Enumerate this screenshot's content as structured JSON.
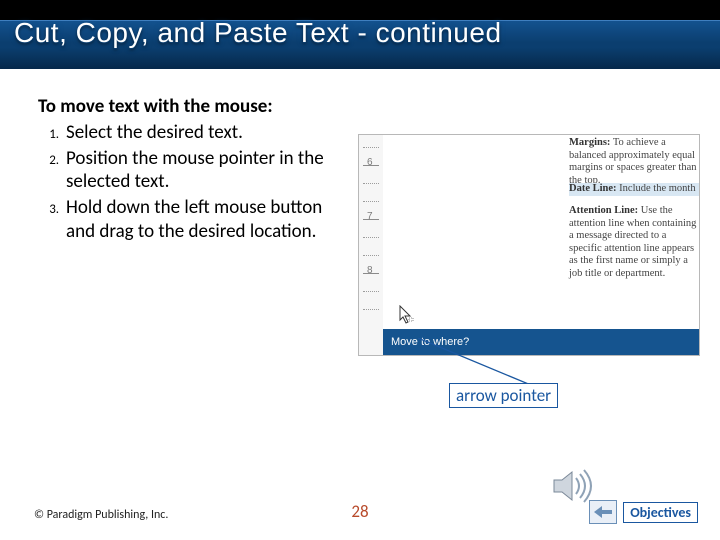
{
  "title": "Cut, Copy, and Paste Text - continued",
  "intro": "To move text with the mouse:",
  "steps": [
    "Select the desired text.",
    "Position the mouse pointer in the selected text.",
    "Hold down the left mouse button and drag to the desired location."
  ],
  "screenshot": {
    "ruler": [
      "6",
      "7",
      "8"
    ],
    "paragraphs": [
      {
        "head": "Margins:",
        "body": " To achieve a balanced approximately equal margins or spaces greater than the top."
      },
      {
        "head": "Date Line:",
        "body": " Include the month"
      },
      {
        "head": "Attention Line:",
        "body": " Use the attention line when containing a message directed to a specific attention line appears as the first name or simply a job title or department."
      }
    ],
    "status": "Move to where?"
  },
  "callout": "arrow pointer",
  "footer": {
    "copyright": "© Paradigm Publishing, Inc.",
    "page": "28",
    "objectives": "Objectives"
  }
}
